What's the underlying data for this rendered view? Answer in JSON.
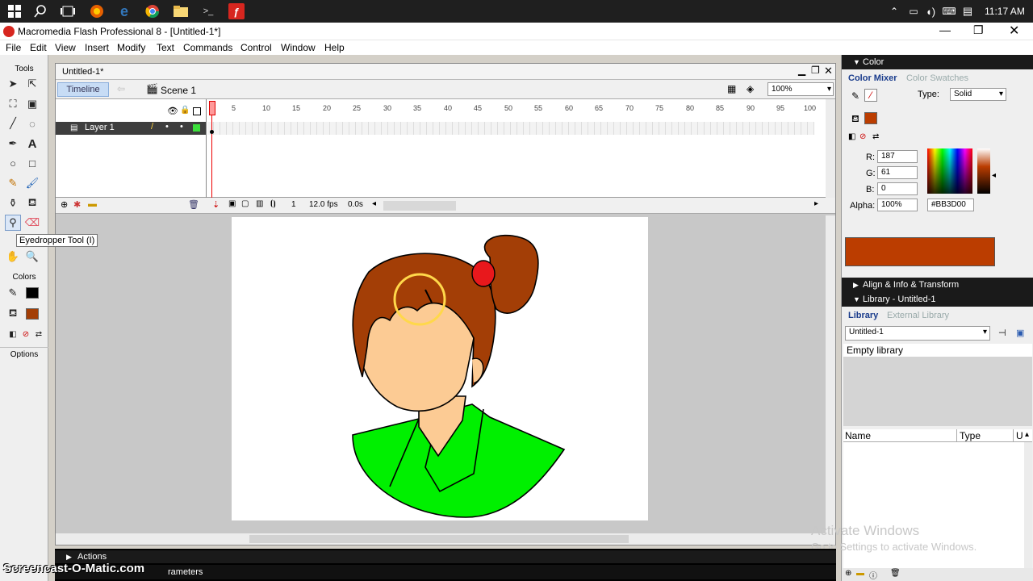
{
  "taskbar": {
    "time": "11:17 AM"
  },
  "window": {
    "title": "Macromedia Flash Professional 8 - [Untitled-1*]"
  },
  "menu": [
    "File",
    "Edit",
    "View",
    "Insert",
    "Modify",
    "Text",
    "Commands",
    "Control",
    "Window",
    "Help"
  ],
  "tools": {
    "tools_label": "Tools",
    "colors_label": "Colors",
    "options_label": "Options",
    "tooltip": "Eyedropper Tool (I)"
  },
  "document": {
    "tab": "Untitled-1*",
    "timeline_btn": "Timeline",
    "scene": "Scene 1",
    "zoom": "100%",
    "layer": "Layer 1",
    "frame_numbers": [
      "5",
      "10",
      "15",
      "20",
      "25",
      "30",
      "35",
      "40",
      "45",
      "50",
      "55",
      "60",
      "65",
      "70",
      "75",
      "80",
      "85",
      "90",
      "95",
      "100"
    ],
    "current_frame": "1",
    "fps": "12.0 fps",
    "time": "0.0s"
  },
  "color_panel": {
    "title": "Color",
    "tab_mixer": "Color Mixer",
    "tab_swatches": "Color Swatches",
    "type_label": "Type:",
    "type_value": "Solid",
    "r_label": "R:",
    "r": "187",
    "g_label": "G:",
    "g": "61",
    "b_label": "B:",
    "b": "0",
    "alpha_label": "Alpha:",
    "alpha": "100%",
    "hex": "#BB3D00",
    "swatch_color": "#BB3D00"
  },
  "align_panel": {
    "title": "Align & Info & Transform"
  },
  "library_panel": {
    "title": "Library - Untitled-1",
    "tab_library": "Library",
    "tab_external": "External Library",
    "doc": "Untitled-1",
    "empty": "Empty library",
    "col_name": "Name",
    "col_type": "Type",
    "col_u": "U"
  },
  "bottom": {
    "actions": "Actions",
    "parameters": "rameters"
  },
  "watermark": "Screencast-O-Matic.com",
  "activate": {
    "line1": "Activate Windows",
    "line2": "Go to Settings to activate Windows."
  },
  "colors": {
    "hair": "#A33E06",
    "skin": "#FCCB94",
    "shirt": "#00F000",
    "bow": "#E8181C",
    "accent": "#3C8EE0"
  }
}
